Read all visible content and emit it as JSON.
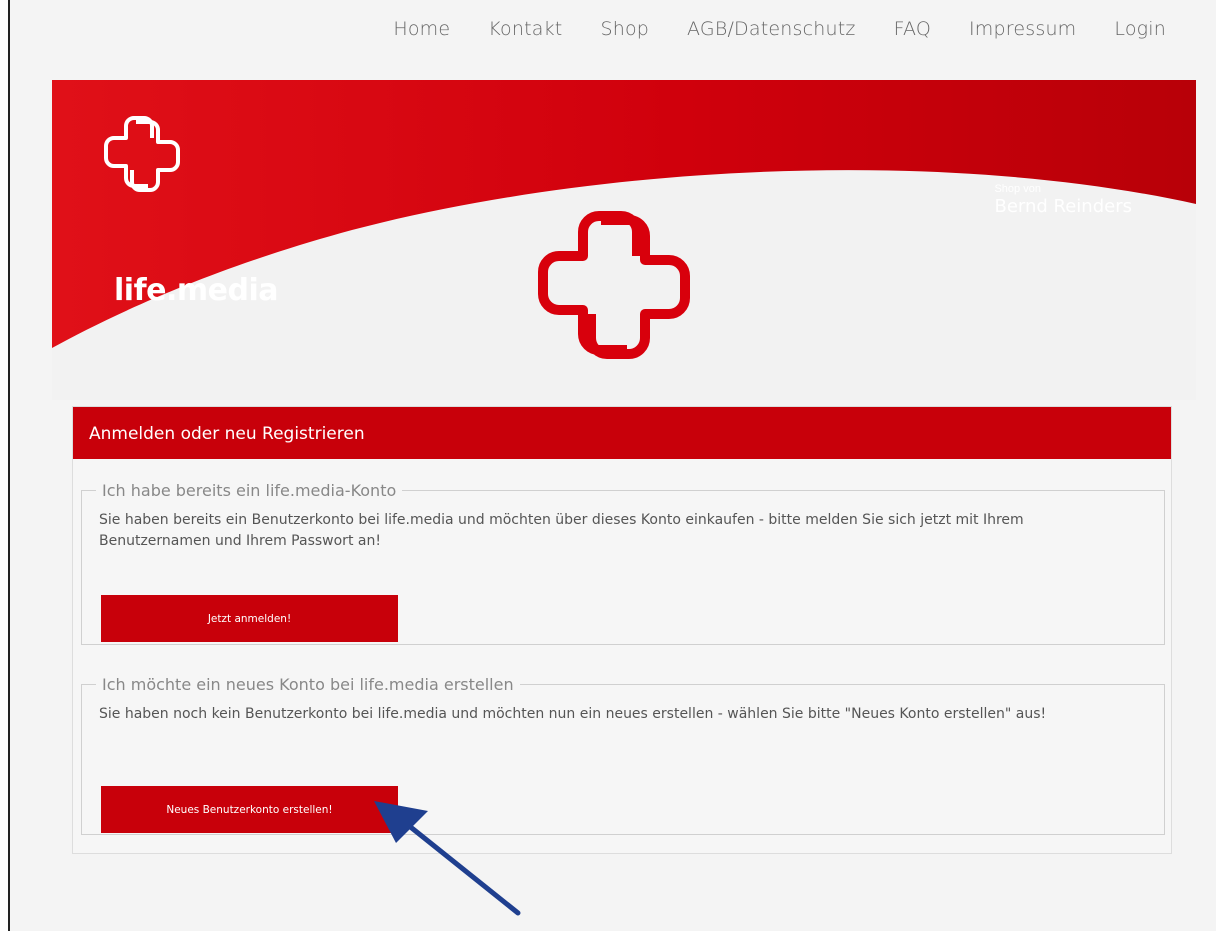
{
  "nav": [
    "Home",
    "Kontakt",
    "Shop",
    "AGB/Datenschutz",
    "FAQ",
    "Impressum",
    "Login"
  ],
  "brand": {
    "name": "life.media",
    "accent": "#c8000a"
  },
  "shop": {
    "label": "Shop von",
    "owner": "Bernd Reinders"
  },
  "panel": {
    "title": "Anmelden oder neu Registrieren",
    "existing": {
      "legend": "Ich habe bereits ein life.media-Konto",
      "text": "Sie haben bereits ein Benutzerkonto bei life.media und möchten über dieses Konto einkaufen - bitte melden Sie sich jetzt mit Ihrem Benutzernamen und Ihrem Passwort an!",
      "button": "Jetzt anmelden!"
    },
    "new": {
      "legend": "Ich möchte ein neues Konto bei life.media erstellen",
      "text": "Sie haben noch kein Benutzerkonto bei life.media und möchten nun ein neues erstellen - wählen Sie bitte \"Neues Konto erstellen\" aus!",
      "button": "Neues Benutzerkonto erstellen!"
    }
  },
  "annotation": {
    "icon": "pointer-arrow-icon",
    "color": "#1f3f8f"
  }
}
